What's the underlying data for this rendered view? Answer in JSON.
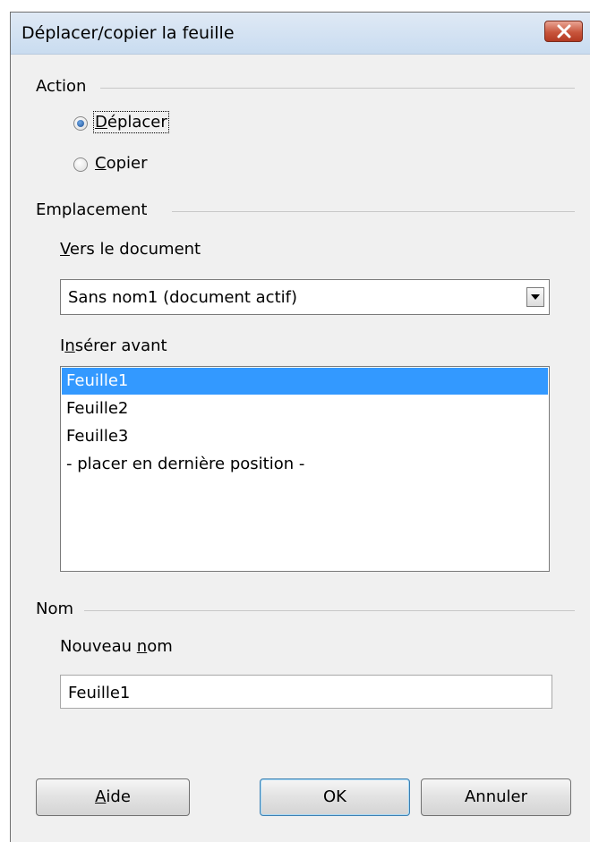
{
  "dialog": {
    "title": "Déplacer/copier la feuille",
    "close_icon": "close-x-icon"
  },
  "action": {
    "label": "Action",
    "options": [
      {
        "label": "Déplacer",
        "mnemonic": "D",
        "rest": "éplacer",
        "checked": true
      },
      {
        "label": "Copier",
        "mnemonic": "C",
        "rest": "opier",
        "checked": false
      }
    ]
  },
  "emplacement": {
    "label": "Emplacement",
    "to_document": {
      "label": "Vers le document",
      "mnemonic": "V",
      "rest": "ers le document",
      "value": "Sans nom1 (document actif)"
    },
    "insert_before": {
      "label": "Insérer avant",
      "prefix": "I",
      "mnemonic": "n",
      "rest": "sérer avant",
      "items": [
        {
          "label": "Feuille1",
          "selected": true
        },
        {
          "label": "Feuille2",
          "selected": false
        },
        {
          "label": "Feuille3",
          "selected": false
        },
        {
          "label": "- placer en dernière position -",
          "selected": false
        }
      ]
    }
  },
  "nom": {
    "label": "Nom",
    "new_name": {
      "label": "Nouveau nom",
      "prefix": "Nouveau ",
      "mnemonic": "n",
      "rest": "om",
      "value": "Feuille1"
    }
  },
  "buttons": {
    "help": {
      "label": "Aide",
      "mnemonic": "A",
      "rest": "ide"
    },
    "ok": {
      "label": "OK"
    },
    "cancel": {
      "label": "Annuler"
    }
  },
  "colors": {
    "selection": "#3399ff",
    "dialog_bg": "#f0f0f0",
    "close_button": "#c8553c"
  }
}
